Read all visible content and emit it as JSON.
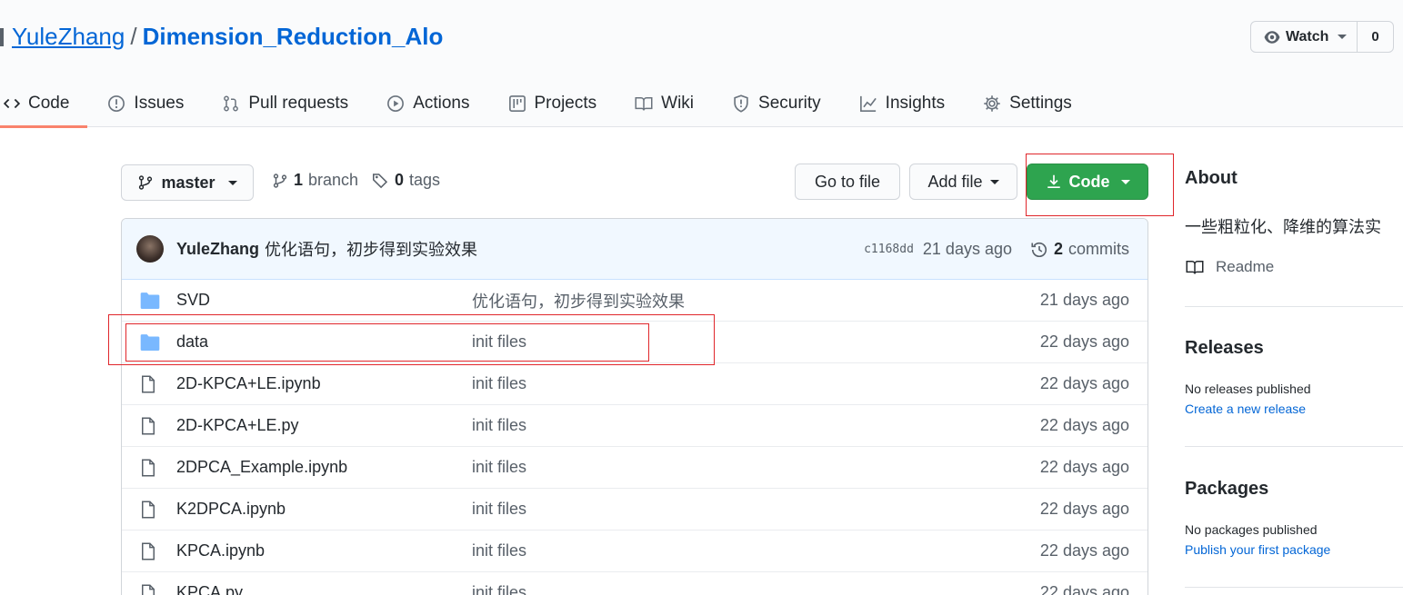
{
  "repo": {
    "owner": "YuleZhang",
    "separator": "/",
    "name": "Dimension_Reduction_Alo"
  },
  "watch": {
    "label": "Watch",
    "count": "0"
  },
  "tabs": [
    {
      "label": "Code",
      "icon": "code-icon"
    },
    {
      "label": "Issues",
      "icon": "issue-icon"
    },
    {
      "label": "Pull requests",
      "icon": "pull-request-icon"
    },
    {
      "label": "Actions",
      "icon": "play-icon"
    },
    {
      "label": "Projects",
      "icon": "project-icon"
    },
    {
      "label": "Wiki",
      "icon": "book-icon"
    },
    {
      "label": "Security",
      "icon": "shield-icon"
    },
    {
      "label": "Insights",
      "icon": "graph-icon"
    },
    {
      "label": "Settings",
      "icon": "gear-icon"
    }
  ],
  "toolbar": {
    "branch": "master",
    "branch_count": "1",
    "branch_word": "branch",
    "tag_count": "0",
    "tag_word": "tags",
    "goto_file": "Go to file",
    "add_file": "Add file",
    "code": "Code"
  },
  "commit": {
    "author": "YuleZhang",
    "message": "优化语句，初步得到实验效果",
    "sha": "c1168dd",
    "age": "21 days ago",
    "commit_count": "2",
    "commit_word": "commits"
  },
  "files": [
    {
      "type": "folder",
      "name": "SVD",
      "message": "优化语句，初步得到实验效果",
      "age": "21 days ago"
    },
    {
      "type": "folder",
      "name": "data",
      "message": "init files",
      "age": "22 days ago"
    },
    {
      "type": "file",
      "name": "2D-KPCA+LE.ipynb",
      "message": "init files",
      "age": "22 days ago"
    },
    {
      "type": "file",
      "name": "2D-KPCA+LE.py",
      "message": "init files",
      "age": "22 days ago"
    },
    {
      "type": "file",
      "name": "2DPCA_Example.ipynb",
      "message": "init files",
      "age": "22 days ago"
    },
    {
      "type": "file",
      "name": "K2DPCA.ipynb",
      "message": "init files",
      "age": "22 days ago"
    },
    {
      "type": "file",
      "name": "KPCA.ipynb",
      "message": "init files",
      "age": "22 days ago"
    },
    {
      "type": "file",
      "name": "KPCA.py",
      "message": "init files",
      "age": "22 days ago"
    }
  ],
  "sidebar": {
    "about_title": "About",
    "about_desc": "一些粗粒化、降维的算法实",
    "readme": "Readme",
    "releases_title": "Releases",
    "releases_none": "No releases published",
    "releases_link": "Create a new release",
    "packages_title": "Packages",
    "packages_none": "No packages published",
    "packages_link": "Publish your first package"
  },
  "colors": {
    "accent": "#0366d6",
    "code_button": "#2ea44f",
    "tab_underline": "#f9826c",
    "highlight_box": "#e0262b"
  }
}
